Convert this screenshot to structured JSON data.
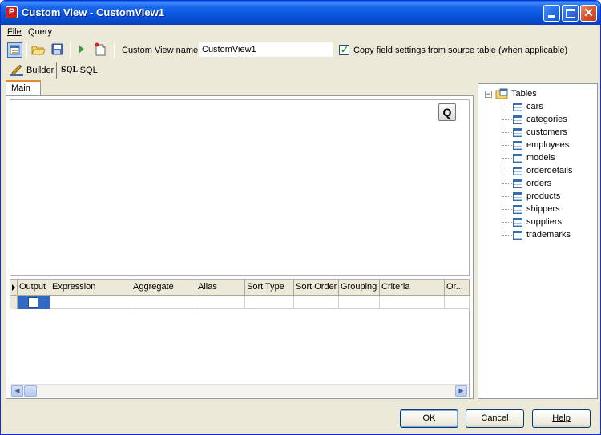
{
  "window": {
    "title": "Custom View - CustomView1",
    "app_icon_letter": "P"
  },
  "menu": {
    "file": "File",
    "query": "Query"
  },
  "toolbar": {
    "custom_view_name_label": "Custom View name",
    "custom_view_name_value": "CustomView1",
    "copy_settings_label": "Copy field settings from source table (when applicable)",
    "copy_settings_checked": true
  },
  "modes": {
    "builder": "Builder",
    "sql_icon": "SQL",
    "sql": "SQL"
  },
  "tabs": {
    "main": "Main"
  },
  "canvas": {
    "q_button": "Q"
  },
  "grid": {
    "columns": [
      "Output",
      "Expression",
      "Aggregate",
      "Alias",
      "Sort Type",
      "Sort Order",
      "Grouping",
      "Criteria",
      "Or..."
    ]
  },
  "tree": {
    "root": "Tables",
    "items": [
      "cars",
      "categories",
      "customers",
      "employees",
      "models",
      "orderdetails",
      "orders",
      "products",
      "shippers",
      "suppliers",
      "trademarks"
    ]
  },
  "buttons": {
    "ok": "OK",
    "cancel": "Cancel",
    "help": "Help"
  },
  "colors": {
    "titlebar": "#0a55dc",
    "selection": "#316ac5",
    "tab_accent": "#e68b2c"
  }
}
